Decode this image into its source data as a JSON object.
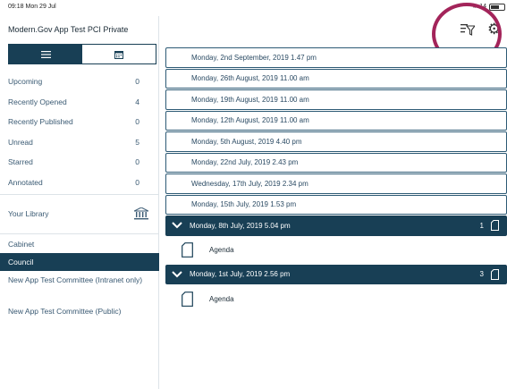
{
  "status": {
    "time": "09:18",
    "date": "Mon 29 Jul",
    "battery": "14"
  },
  "app": {
    "title": "Modern.Gov App Test PCI Private"
  },
  "view_toggle": {
    "list_icon": "list-icon",
    "calendar_icon": "calendar-icon",
    "active": "list"
  },
  "counts": [
    {
      "label": "Upcoming",
      "count": "0"
    },
    {
      "label": "Recently Opened",
      "count": "4"
    },
    {
      "label": "Recently Published",
      "count": "0"
    },
    {
      "label": "Unread",
      "count": "5"
    },
    {
      "label": "Starred",
      "count": "0"
    },
    {
      "label": "Annotated",
      "count": "0"
    }
  ],
  "library": {
    "label": "Your Library",
    "icon": "library-icon"
  },
  "committees": [
    {
      "label": "Cabinet",
      "selected": false
    },
    {
      "label": "Council",
      "selected": true
    },
    {
      "label": "New App Test Committee (Intranet only)",
      "selected": false
    },
    {
      "label": "New App Test Committee (Public)",
      "selected": false
    }
  ],
  "toolbar": {
    "filter_icon": "filter-icon",
    "settings_icon": "gear-icon"
  },
  "meetings": [
    {
      "date": "Monday, 2nd September, 2019 1.47 pm"
    },
    {
      "date": "Monday, 26th August, 2019 11.00 am"
    },
    {
      "date": "Monday, 19th August, 2019 11.00 am"
    },
    {
      "date": "Monday, 12th August, 2019 11.00 am"
    },
    {
      "date": "Monday, 5th August, 2019 4.40 pm"
    },
    {
      "date": "Monday, 22nd July, 2019 2.43 pm"
    },
    {
      "date": "Wednesday, 17th July, 2019 2.34 pm"
    },
    {
      "date": "Monday, 15th July, 2019 1.53 pm"
    }
  ],
  "expanded_meetings": [
    {
      "date": "Monday, 8th July, 2019 5.04 pm",
      "doc_count": "1",
      "documents": [
        {
          "title": "Agenda"
        }
      ]
    },
    {
      "date": "Monday, 1st July, 2019 2.56 pm",
      "doc_count": "3",
      "documents": [
        {
          "title": "Agenda"
        }
      ]
    }
  ],
  "colors": {
    "primary": "#183f55",
    "highlight": "#a3245a",
    "text": "#3a5a73"
  }
}
